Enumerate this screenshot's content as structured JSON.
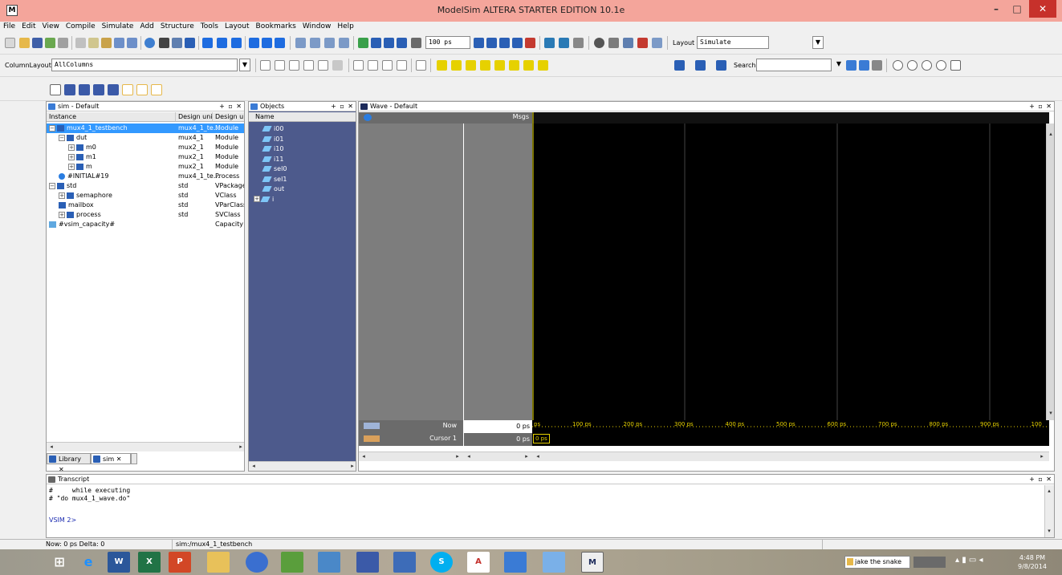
{
  "window": {
    "title": "ModelSim ALTERA STARTER EDITION 10.1e",
    "app_icon": "M",
    "min": "–",
    "max": "□",
    "close": "✕"
  },
  "menu": [
    "File",
    "Edit",
    "View",
    "Compile",
    "Simulate",
    "Add",
    "Structure",
    "Tools",
    "Layout",
    "Bookmarks",
    "Window",
    "Help"
  ],
  "toolbar": {
    "time_step": "100 ps",
    "layout_label": "Layout",
    "layout_value": "Simulate",
    "column_layout_label": "ColumnLayout",
    "column_layout_value": "AllColumns",
    "search_label": "Search:",
    "search_value": ""
  },
  "sim_pane": {
    "title": "sim - Default",
    "columns": [
      "Instance",
      "Design unit",
      "Design unit type"
    ],
    "rows": [
      {
        "instance": "mux4_1_testbench",
        "unit": "mux4_1_te...",
        "type": "Module",
        "indent": 0,
        "expander": "−",
        "icon": "module",
        "selected": true
      },
      {
        "instance": "dut",
        "unit": "mux4_1",
        "type": "Module",
        "indent": 1,
        "expander": "−",
        "icon": "module",
        "selected": false
      },
      {
        "instance": "m0",
        "unit": "mux2_1",
        "type": "Module",
        "indent": 2,
        "expander": "+",
        "icon": "module",
        "selected": false
      },
      {
        "instance": "m1",
        "unit": "mux2_1",
        "type": "Module",
        "indent": 2,
        "expander": "+",
        "icon": "module",
        "selected": false
      },
      {
        "instance": "m",
        "unit": "mux2_1",
        "type": "Module",
        "indent": 2,
        "expander": "+",
        "icon": "module",
        "selected": false
      },
      {
        "instance": "#INITIAL#19",
        "unit": "mux4_1_te...",
        "type": "Process",
        "indent": 1,
        "expander": "",
        "icon": "process",
        "selected": false
      },
      {
        "instance": "std",
        "unit": "std",
        "type": "VPackage",
        "indent": 0,
        "expander": "−",
        "icon": "module",
        "selected": false
      },
      {
        "instance": "semaphore",
        "unit": "std",
        "type": "VClass",
        "indent": 1,
        "expander": "+",
        "icon": "module",
        "selected": false
      },
      {
        "instance": "mailbox",
        "unit": "std",
        "type": "VParClass",
        "indent": 1,
        "expander": "",
        "icon": "module",
        "selected": false
      },
      {
        "instance": "process",
        "unit": "std",
        "type": "SVClass",
        "indent": 1,
        "expander": "+",
        "icon": "module",
        "selected": false
      },
      {
        "instance": "#vsim_capacity#",
        "unit": "",
        "type": "Capacity",
        "indent": 0,
        "expander": "",
        "icon": "capacity",
        "selected": false
      }
    ],
    "tabs": [
      "Library",
      "sim"
    ]
  },
  "objects_pane": {
    "title": "Objects",
    "column": "Name",
    "rows": [
      {
        "name": "i00",
        "expander": ""
      },
      {
        "name": "i01",
        "expander": ""
      },
      {
        "name": "i10",
        "expander": ""
      },
      {
        "name": "i11",
        "expander": ""
      },
      {
        "name": "sel0",
        "expander": ""
      },
      {
        "name": "sel1",
        "expander": ""
      },
      {
        "name": "out",
        "expander": ""
      },
      {
        "name": "i",
        "expander": "+"
      }
    ]
  },
  "wave_pane": {
    "title": "Wave - Default",
    "msgs_label": "Msgs",
    "now_label": "Now",
    "now_value": "0 ps",
    "cursor_label": "Cursor 1",
    "cursor_value": "0 ps",
    "cursor_marker": "0 ps",
    "timeline_start": "ps",
    "timeline_ticks": [
      "100 ps",
      "200 ps",
      "300 ps",
      "400 ps",
      "500 ps",
      "600 ps",
      "700 ps",
      "800 ps",
      "900 ps",
      "100"
    ]
  },
  "transcript": {
    "title": "Transcript",
    "lines": [
      "#     while executing",
      "# \"do mux4_1_wave.do\"",
      "",
      "VSIM 2>"
    ]
  },
  "status": {
    "now": "Now: 0 ps  Delta: 0",
    "context": "sim:/mux4_1_testbench"
  },
  "taskbar": {
    "search_text": "jake the snake",
    "time": "4:48 PM",
    "date": "9/8/2014"
  },
  "colors": {
    "title_bar": "#f4a59b",
    "objects_bg": "#4d5a8c",
    "wave_gray": "#7d7d7d",
    "selection": "#3399ff",
    "cursor": "#f2e400",
    "timeline": "#e6d100"
  }
}
